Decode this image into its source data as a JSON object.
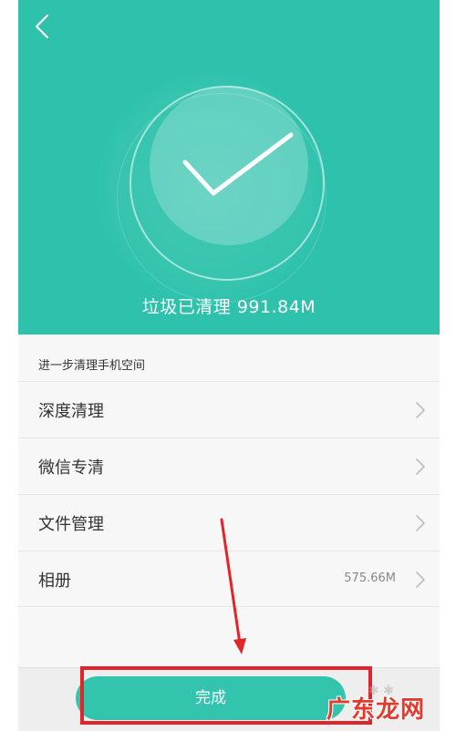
{
  "header": {
    "back_icon": "chevron-left-icon"
  },
  "hero": {
    "status_text": "垃圾已清理 991.84M",
    "check_icon": "checkmark-icon",
    "background_color": "#2ec2ac"
  },
  "section": {
    "label": "进一步清理手机空间"
  },
  "list": {
    "items": [
      {
        "label": "深度清理",
        "value": ""
      },
      {
        "label": "微信专清",
        "value": ""
      },
      {
        "label": "文件管理",
        "value": ""
      },
      {
        "label": "相册",
        "value": "575.66M"
      }
    ]
  },
  "footer": {
    "done_label": "完成",
    "button_color": "#33c4ae"
  },
  "overlay": {
    "highlight_color": "#e2242b",
    "watermark_text": "广东龙网"
  }
}
